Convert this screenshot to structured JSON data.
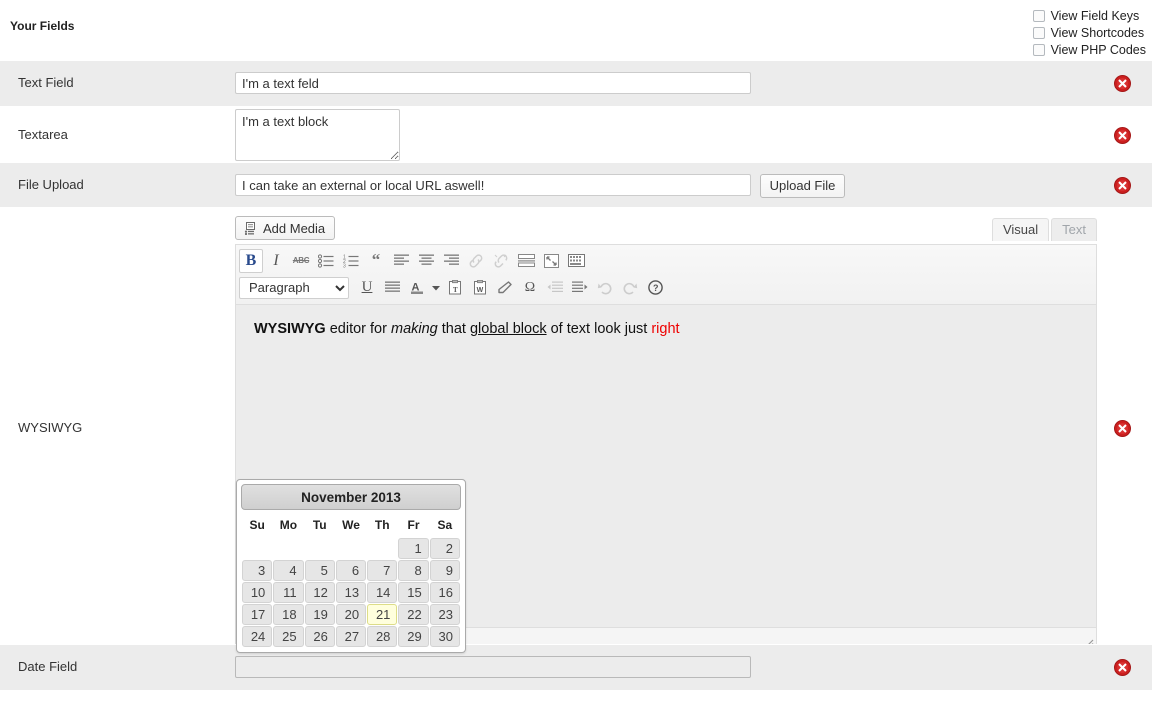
{
  "header": {
    "title": "Your Fields",
    "view_options": [
      {
        "label": "View Field Keys",
        "checked": false
      },
      {
        "label": "View Shortcodes",
        "checked": false
      },
      {
        "label": "View PHP Codes",
        "checked": false
      }
    ]
  },
  "rows": {
    "text_field": {
      "label": "Text Field",
      "value": "I'm a text feld",
      "placeholder": ""
    },
    "textarea": {
      "label": "Textarea",
      "value": "I'm a text block",
      "placeholder": ""
    },
    "file_upload": {
      "label": "File Upload",
      "value": "I can take an external or local URL aswell!",
      "placeholder": "",
      "button_label": "Upload File"
    },
    "wysiwyg": {
      "label": "WYSIWYG",
      "add_media_label": "Add Media",
      "tabs": [
        {
          "label": "Visual",
          "active": true
        },
        {
          "label": "Text",
          "active": false
        }
      ],
      "format_select": "Paragraph",
      "content": {
        "bold": "WYSIWYG",
        "plain1": " editor for ",
        "italic": "making",
        "plain2": " that ",
        "underline": "global block",
        "plain3": " of text look just ",
        "red": "right"
      },
      "toolbar_row1": [
        {
          "name": "bold-icon",
          "glyph": "B",
          "active": true,
          "disabled": false
        },
        {
          "name": "italic-icon",
          "glyph": "I",
          "active": false,
          "disabled": false
        },
        {
          "name": "strikethrough-icon",
          "glyph": "ABC",
          "active": false,
          "disabled": false
        },
        {
          "name": "unordered-list-icon",
          "glyph": "",
          "active": false,
          "disabled": false
        },
        {
          "name": "ordered-list-icon",
          "glyph": "",
          "active": false,
          "disabled": false
        },
        {
          "name": "blockquote-icon",
          "glyph": "“",
          "active": false,
          "disabled": false
        },
        {
          "name": "align-left-icon",
          "glyph": "",
          "active": false,
          "disabled": false
        },
        {
          "name": "align-center-icon",
          "glyph": "",
          "active": false,
          "disabled": false
        },
        {
          "name": "align-right-icon",
          "glyph": "",
          "active": false,
          "disabled": false
        },
        {
          "name": "insert-link-icon",
          "glyph": "",
          "active": false,
          "disabled": true
        },
        {
          "name": "unlink-icon",
          "glyph": "",
          "active": false,
          "disabled": true
        },
        {
          "name": "insert-more-tag-icon",
          "glyph": "",
          "active": false,
          "disabled": false
        },
        {
          "name": "fullscreen-icon",
          "glyph": "",
          "active": false,
          "disabled": false
        },
        {
          "name": "kitchen-sink-icon",
          "glyph": "",
          "active": false,
          "disabled": false
        }
      ],
      "toolbar_row2": [
        {
          "name": "underline-icon",
          "glyph": "U",
          "active": false,
          "disabled": false
        },
        {
          "name": "align-justify-icon",
          "glyph": "",
          "active": false,
          "disabled": false
        },
        {
          "name": "text-color-icon",
          "glyph": "A",
          "active": false,
          "disabled": false
        },
        {
          "name": "text-color-dropdown-icon",
          "glyph": "",
          "active": false,
          "disabled": false
        },
        {
          "name": "paste-as-text-icon",
          "glyph": "",
          "active": false,
          "disabled": false
        },
        {
          "name": "paste-from-word-icon",
          "glyph": "",
          "active": false,
          "disabled": false
        },
        {
          "name": "remove-formatting-icon",
          "glyph": "",
          "active": false,
          "disabled": false
        },
        {
          "name": "special-character-icon",
          "glyph": "Ω",
          "active": false,
          "disabled": false
        },
        {
          "name": "outdent-icon",
          "glyph": "",
          "active": false,
          "disabled": true
        },
        {
          "name": "indent-icon",
          "glyph": "",
          "active": false,
          "disabled": false
        },
        {
          "name": "undo-icon",
          "glyph": "",
          "active": false,
          "disabled": true
        },
        {
          "name": "redo-icon",
          "glyph": "",
          "active": false,
          "disabled": true
        },
        {
          "name": "help-icon",
          "glyph": "?",
          "active": false,
          "disabled": false
        }
      ]
    },
    "date_field": {
      "label": "Date Field",
      "value": "",
      "placeholder": ""
    }
  },
  "datepicker": {
    "title": "November 2013",
    "weekdays": [
      "Su",
      "Mo",
      "Tu",
      "We",
      "Th",
      "Fr",
      "Sa"
    ],
    "leading_blanks": 5,
    "days": [
      1,
      2,
      3,
      4,
      5,
      6,
      7,
      8,
      9,
      10,
      11,
      12,
      13,
      14,
      15,
      16,
      17,
      18,
      19,
      20,
      21,
      22,
      23,
      24,
      25,
      26,
      27,
      28,
      29,
      30
    ],
    "today": 21
  },
  "colors": {
    "row_alt_bg": "#ececec",
    "row_bg": "#ffffff",
    "delete_icon": "#cc1f1f",
    "accent_red_text": "#ee0000",
    "today_highlight": "#ffffdd"
  }
}
